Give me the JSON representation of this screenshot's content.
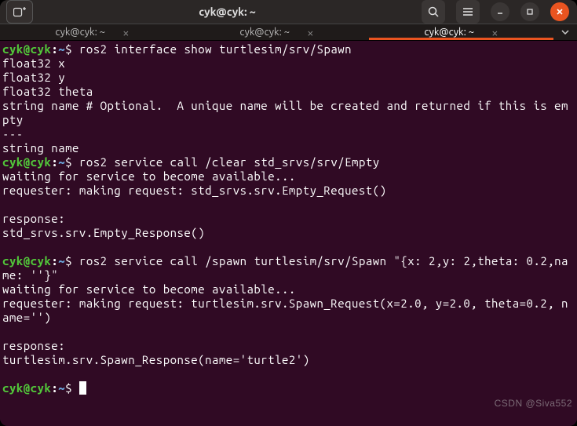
{
  "window": {
    "title": "cyk@cyk: ~"
  },
  "tabs": [
    {
      "label": "cyk@cyk: ~",
      "active": false
    },
    {
      "label": "cyk@cyk: ~",
      "active": false
    },
    {
      "label": "cyk@cyk: ~",
      "active": true
    }
  ],
  "prompt": {
    "user": "cyk@cyk",
    "colon": ":",
    "path": "~",
    "sym": "$ "
  },
  "term": {
    "cmd1": "ros2 interface show turtlesim/srv/Spawn",
    "l1": "float32 x",
    "l2": "float32 y",
    "l3": "float32 theta",
    "l4": "string name # Optional.  A unique name will be created and returned if this is empty",
    "l5": "---",
    "l6": "string name",
    "cmd2": "ros2 service call /clear std_srvs/srv/Empty",
    "l7": "waiting for service to become available...",
    "l8": "requester: making request: std_srvs.srv.Empty_Request()",
    "blank": "",
    "l9": "response:",
    "l10": "std_srvs.srv.Empty_Response()",
    "cmd3": "ros2 service call /spawn turtlesim/srv/Spawn \"{x: 2,y: 2,theta: 0.2,name: ''}\"",
    "l11": "waiting for service to become available...",
    "l12": "requester: making request: turtlesim.srv.Spawn_Request(x=2.0, y=2.0, theta=0.2, name='')",
    "l13": "response:",
    "l14": "turtlesim.srv.Spawn_Response(name='turtle2')"
  },
  "watermark": "CSDN @Siva552"
}
